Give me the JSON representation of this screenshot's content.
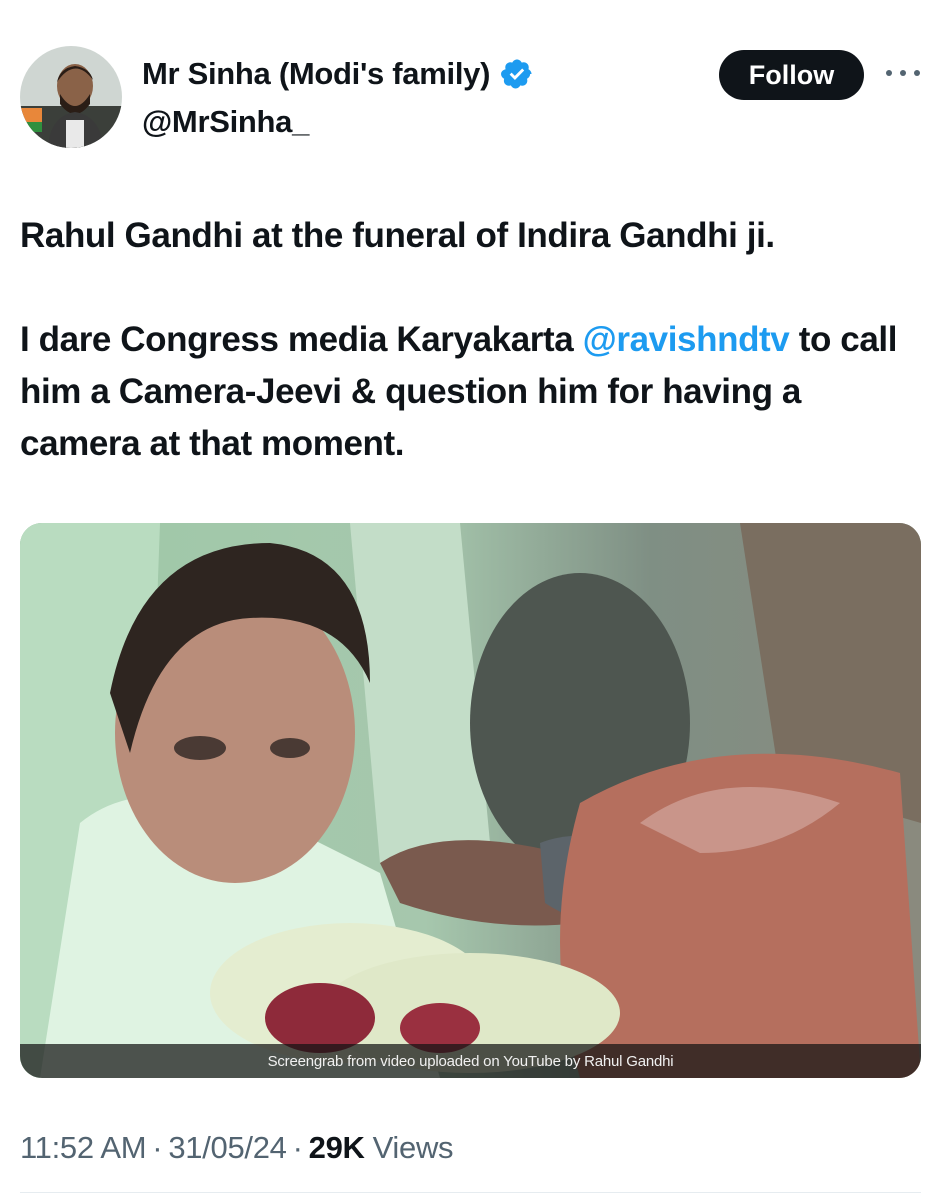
{
  "author": {
    "display_name": "Mr Sinha (Modi's family)",
    "handle": "@MrSinha_",
    "verified": true
  },
  "follow_label": "Follow",
  "tweet": {
    "line1": "Rahul Gandhi at the funeral of Indira Gandhi ji.",
    "para2_before": "I dare Congress media Karyakarta ",
    "mention": "@ravishndtv",
    "para2_after": " to call him a Camera-Jeevi & question him for having a camera at that moment."
  },
  "media": {
    "caption": "Screengrab from video uploaded on YouTube by Rahul Gandhi"
  },
  "meta": {
    "time": "11:52 AM",
    "date": "31/05/24",
    "views_count": "29K",
    "views_label": "Views",
    "separator": "·"
  },
  "colors": {
    "accent": "#1d9bf0",
    "text": "#0f1419",
    "muted": "#536471",
    "follow_bg": "#0f1419"
  },
  "icons": {
    "verified": "verified-badge-icon",
    "more": "more-options-icon"
  }
}
